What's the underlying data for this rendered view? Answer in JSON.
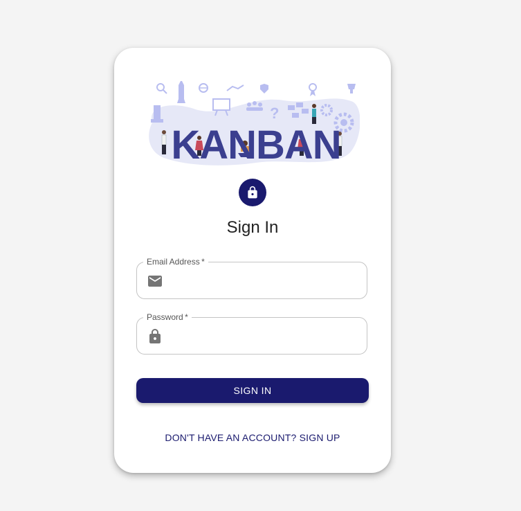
{
  "hero": {
    "logo_text": "KANBAN",
    "colors": {
      "logo_text": "#3b3f8f",
      "backdrop": "#e6e8f7",
      "decor": "#b8bdf0"
    }
  },
  "header": {
    "icon": "lock-icon",
    "title": "Sign In"
  },
  "form": {
    "email": {
      "label": "Email Address",
      "required_mark": "*",
      "value": "",
      "icon": "email-icon"
    },
    "password": {
      "label": "Password",
      "required_mark": "*",
      "value": "",
      "icon": "lock-icon"
    },
    "submit_label": "SIGN IN"
  },
  "footer": {
    "signup_link": "DON'T HAVE AN ACCOUNT? SIGN UP"
  },
  "colors": {
    "primary": "#1a1a6e",
    "page_bg": "#f4f4f4",
    "card_bg": "#ffffff"
  }
}
